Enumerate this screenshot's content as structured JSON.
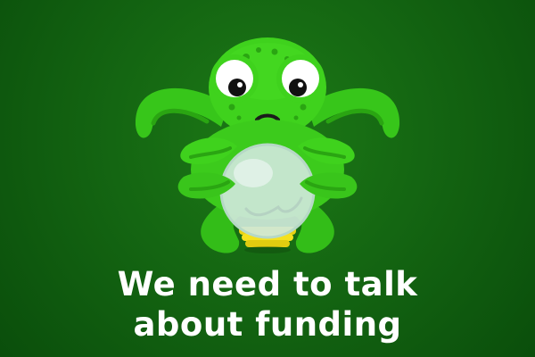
{
  "headline": {
    "line1": "We need to talk",
    "line2": "about funding"
  },
  "mascot": {
    "icon": "octopus-with-crystal-ball-icon"
  },
  "colors": {
    "background": "#146612",
    "mascot_body": "#3fd21d",
    "mascot_shadow": "#2aa512",
    "text": "#ffffff",
    "crystal_ball": "#cfe8da",
    "stand": "#f5e11e"
  }
}
